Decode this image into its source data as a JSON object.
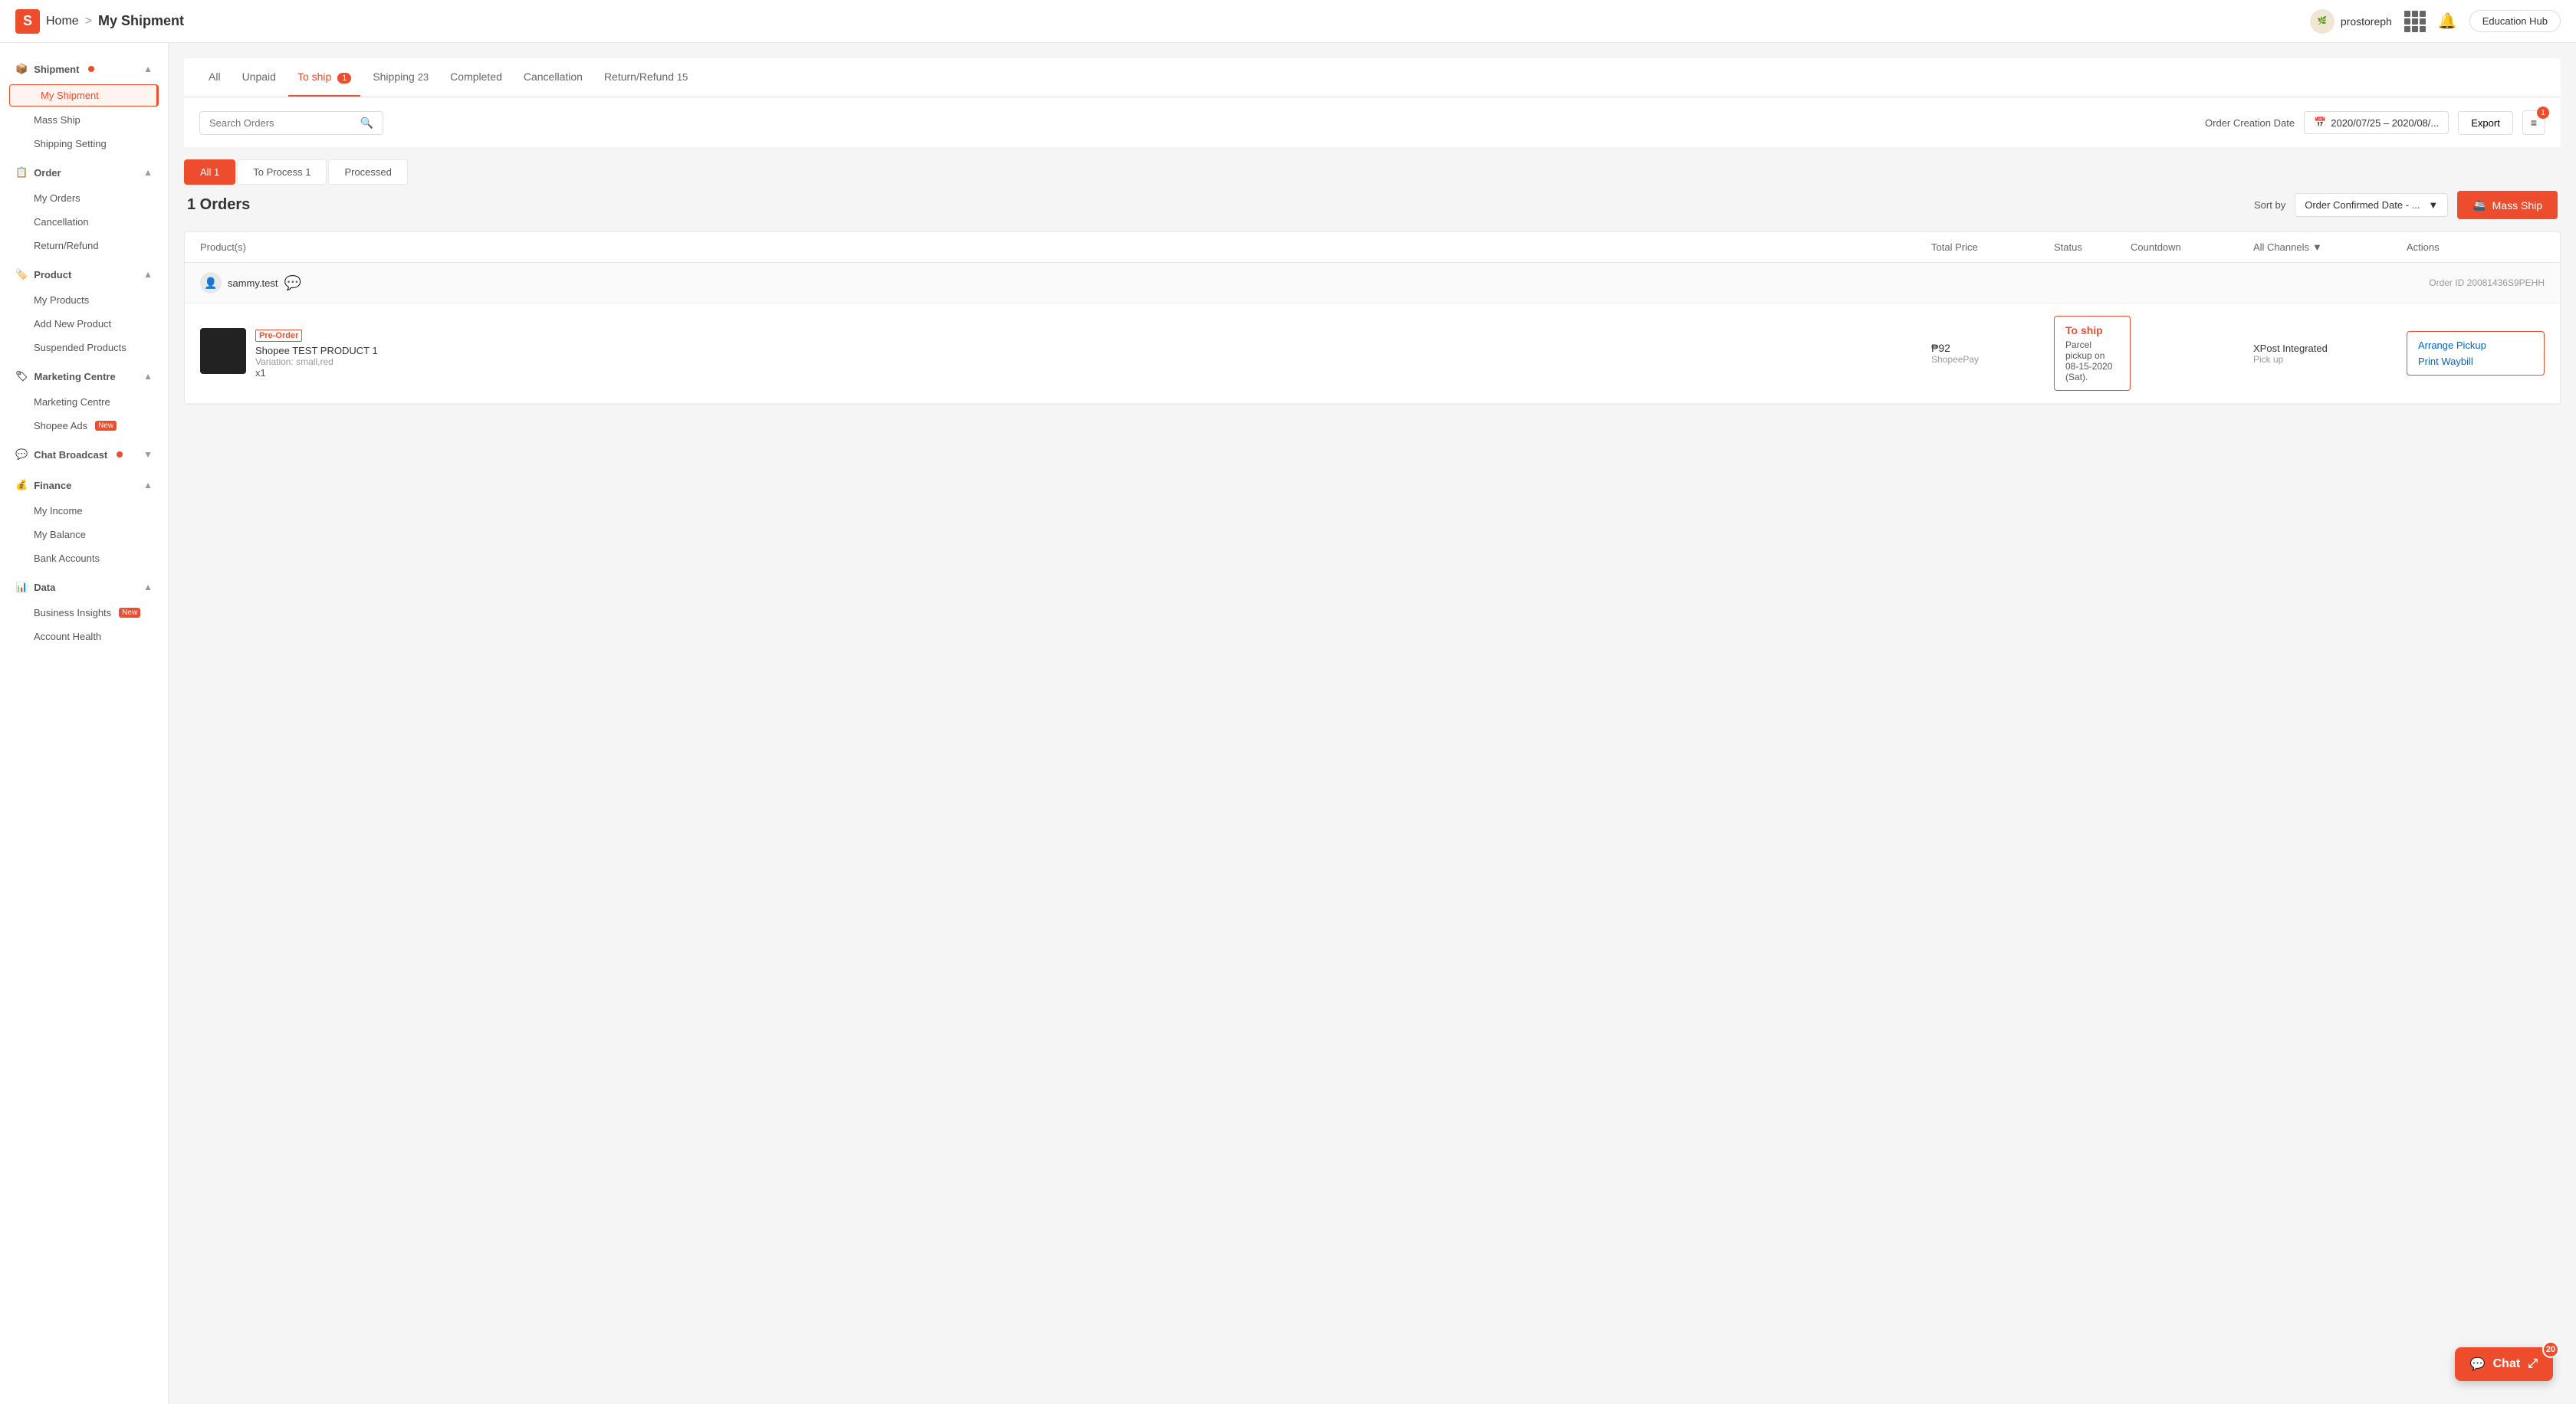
{
  "app": {
    "logo_letter": "S",
    "home_label": "Home",
    "breadcrumb_separator": ">",
    "page_title": "My Shipment"
  },
  "topnav": {
    "username": "prostoreph",
    "grid_icon": "⊞",
    "bell_icon": "🔔",
    "edu_hub_label": "Education Hub"
  },
  "sidebar": {
    "sections": [
      {
        "title": "Shipment",
        "has_dot": true,
        "items": [
          {
            "label": "My Shipment",
            "active": true,
            "boxed": true
          },
          {
            "label": "Mass Ship",
            "active": false
          },
          {
            "label": "Shipping Setting",
            "active": false
          }
        ]
      },
      {
        "title": "Order",
        "has_dot": false,
        "items": [
          {
            "label": "My Orders",
            "active": false
          },
          {
            "label": "Cancellation",
            "active": false
          },
          {
            "label": "Return/Refund",
            "active": false
          }
        ]
      },
      {
        "title": "Product",
        "has_dot": false,
        "items": [
          {
            "label": "My Products",
            "active": false
          },
          {
            "label": "Add New Product",
            "active": false
          },
          {
            "label": "Suspended Products",
            "active": false
          }
        ]
      },
      {
        "title": "Marketing Centre",
        "has_dot": false,
        "items": [
          {
            "label": "Marketing Centre",
            "active": false
          },
          {
            "label": "Shopee Ads",
            "badge": "New",
            "active": false
          }
        ]
      },
      {
        "title": "Chat Broadcast",
        "has_dot": true,
        "items": []
      },
      {
        "title": "Finance",
        "has_dot": false,
        "items": [
          {
            "label": "My Income",
            "active": false
          },
          {
            "label": "My Balance",
            "active": false
          },
          {
            "label": "Bank Accounts",
            "active": false
          }
        ]
      },
      {
        "title": "Data",
        "has_dot": false,
        "items": [
          {
            "label": "Business Insights",
            "badge": "New",
            "active": false
          },
          {
            "label": "Account Health",
            "active": false
          }
        ]
      }
    ]
  },
  "tabs": [
    {
      "label": "All",
      "count": null,
      "active": false
    },
    {
      "label": "Unpaid",
      "count": null,
      "active": false
    },
    {
      "label": "To ship",
      "count": "1",
      "active": true
    },
    {
      "label": "Shipping",
      "count": "23",
      "active": false
    },
    {
      "label": "Completed",
      "count": null,
      "active": false
    },
    {
      "label": "Cancellation",
      "count": null,
      "active": false
    },
    {
      "label": "Return/Refund",
      "count": "15",
      "active": false
    }
  ],
  "search": {
    "placeholder": "Search Orders"
  },
  "filter": {
    "date_label": "Order Creation Date",
    "date_value": "2020/07/25 – 2020/08/...",
    "export_label": "Export",
    "filter_count": "1"
  },
  "sub_tabs": [
    {
      "label": "All 1",
      "active": true
    },
    {
      "label": "To Process 1",
      "active": false
    },
    {
      "label": "Processed",
      "active": false
    }
  ],
  "orders": {
    "count_label": "1 Orders",
    "sort_label": "Sort by",
    "sort_value": "Order Confirmed Date - ...",
    "mass_ship_label": "Mass Ship",
    "table_headers": {
      "product": "Product(s)",
      "total_price": "Total Price",
      "status": "Status",
      "countdown": "Countdown",
      "channels": "All Channels",
      "actions": "Actions"
    },
    "items": [
      {
        "username": "sammy.test",
        "order_id": "Order ID 20081436S9PEHH",
        "has_chat": true,
        "product": {
          "pre_order": true,
          "pre_order_label": "Pre-Order",
          "name": "Shopee TEST PRODUCT 1",
          "variation": "Variation: small,red",
          "qty": "x1",
          "thumb_color": "#222222"
        },
        "price": "₱92",
        "payment": "ShopeePay",
        "status": "To ship",
        "status_detail": "Parcel pickup on 08-15-2020 (Sat).",
        "logistics_name": "XPost Integrated",
        "logistics_type": "Pick up",
        "actions": [
          {
            "label": "Arrange Pickup"
          },
          {
            "label": "Print Waybill"
          }
        ]
      }
    ]
  },
  "chat_fab": {
    "label": "Chat",
    "badge": "20"
  }
}
